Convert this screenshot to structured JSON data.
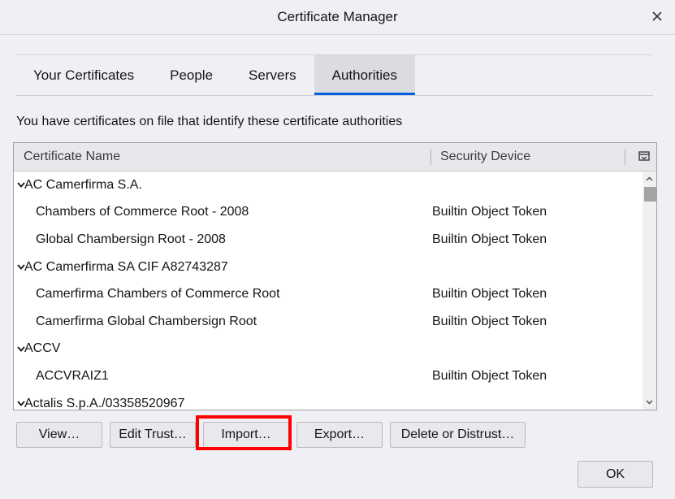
{
  "window": {
    "title": "Certificate Manager"
  },
  "tabs": [
    {
      "label": "Your Certificates",
      "selected": false
    },
    {
      "label": "People",
      "selected": false
    },
    {
      "label": "Servers",
      "selected": false
    },
    {
      "label": "Authorities",
      "selected": true
    }
  ],
  "description": "You have certificates on file that identify these certificate authorities",
  "tree": {
    "columns": {
      "name": "Certificate Name",
      "device": "Security Device"
    },
    "rows": [
      {
        "type": "group",
        "name": "AC Camerfirma S.A.",
        "device": ""
      },
      {
        "type": "child",
        "name": "Chambers of Commerce Root - 2008",
        "device": "Builtin Object Token"
      },
      {
        "type": "child",
        "name": "Global Chambersign Root - 2008",
        "device": "Builtin Object Token"
      },
      {
        "type": "group",
        "name": "AC Camerfirma SA CIF A82743287",
        "device": ""
      },
      {
        "type": "child",
        "name": "Camerfirma Chambers of Commerce Root",
        "device": "Builtin Object Token"
      },
      {
        "type": "child",
        "name": "Camerfirma Global Chambersign Root",
        "device": "Builtin Object Token"
      },
      {
        "type": "group",
        "name": "ACCV",
        "device": ""
      },
      {
        "type": "child",
        "name": "ACCVRAIZ1",
        "device": "Builtin Object Token"
      },
      {
        "type": "group",
        "name": "Actalis S.p.A./03358520967",
        "device": ""
      }
    ]
  },
  "buttons": {
    "view": "View…",
    "edit_trust": "Edit Trust…",
    "import": "Import…",
    "export": "Export…",
    "delete_or_distrust": "Delete or Distrust…",
    "ok": "OK"
  },
  "colors": {
    "accent": "#0060df",
    "highlight": "#ff0000"
  }
}
